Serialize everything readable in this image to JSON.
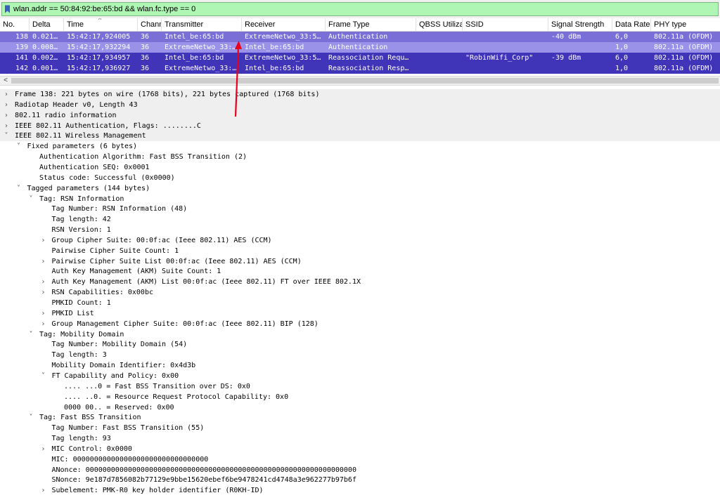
{
  "filter": {
    "value": "wlan.addr == 50:84:92:be:65:bd && wlan.fc.type == 0",
    "icon": "bookmark-icon"
  },
  "packet_list": {
    "columns": [
      "No.",
      "Delta",
      "Time",
      "Channel",
      "Transmitter",
      "Receiver",
      "Frame Type",
      "QBSS Utilization",
      "SSID",
      "Signal Strength",
      "Data Rate",
      "PHY type"
    ],
    "columns_shown": [
      "No.",
      "Delta",
      "Time",
      "Chann",
      "Transmitter",
      "Receiver",
      "Frame Type",
      "QBSS Utiliza",
      "SSID",
      "Signal Strength",
      "Data Rate",
      "PHY type"
    ],
    "rows": [
      {
        "no": "138",
        "delta": "0.021…",
        "time": "15:42:17,924005",
        "channel": "36",
        "transmitter": "Intel_be:65:bd",
        "receiver": "ExtremeNetwo_33:5…",
        "frame_type": "Authentication",
        "qbss": "",
        "ssid": "",
        "signal": "-40 dBm",
        "rate": "6,0",
        "phy": "802.11a (OFDM)"
      },
      {
        "no": "139",
        "delta": "0.008…",
        "time": "15:42:17,932294",
        "channel": "36",
        "transmitter": "ExtremeNetwo_33:…",
        "receiver": "Intel_be:65:bd",
        "frame_type": "Authentication",
        "qbss": "",
        "ssid": "",
        "signal": "",
        "rate": "1,0",
        "phy": "802.11a (OFDM)"
      },
      {
        "no": "141",
        "delta": "0.002…",
        "time": "15:42:17,934957",
        "channel": "36",
        "transmitter": "Intel_be:65:bd",
        "receiver": "ExtremeNetwo_33:5…",
        "frame_type": "Reassociation Requ…",
        "qbss": "",
        "ssid": "\"RobinWifi_Corp\"",
        "signal": "-39 dBm",
        "rate": "6,0",
        "phy": "802.11a (OFDM)"
      },
      {
        "no": "142",
        "delta": "0.001…",
        "time": "15:42:17,936927",
        "channel": "36",
        "transmitter": "ExtremeNetwo_33:…",
        "receiver": "Intel_be:65:bd",
        "frame_type": "Reassociation Resp…",
        "qbss": "",
        "ssid": "",
        "signal": "",
        "rate": "1,0",
        "phy": "802.11a (OFDM)"
      }
    ]
  },
  "scrollbar": {
    "left_arrow": "<"
  },
  "details": [
    {
      "level": 0,
      "toggle": ">",
      "text": "Frame 138: 221 bytes on wire (1768 bits), 221 bytes captured (1768 bits)"
    },
    {
      "level": 0,
      "toggle": ">",
      "text": "Radiotap Header v0, Length 43"
    },
    {
      "level": 0,
      "toggle": ">",
      "text": "802.11 radio information"
    },
    {
      "level": 0,
      "toggle": ">",
      "text": "IEEE 802.11 Authentication, Flags: ........C"
    },
    {
      "level": 0,
      "toggle": "v",
      "text": "IEEE 802.11 Wireless Management"
    },
    {
      "level": 1,
      "toggle": "v",
      "text": "Fixed parameters (6 bytes)"
    },
    {
      "level": 2,
      "toggle": "",
      "text": "Authentication Algorithm: Fast BSS Transition (2)"
    },
    {
      "level": 2,
      "toggle": "",
      "text": "Authentication SEQ: 0x0001"
    },
    {
      "level": 2,
      "toggle": "",
      "text": "Status code: Successful (0x0000)"
    },
    {
      "level": 1,
      "toggle": "v",
      "text": "Tagged parameters (144 bytes)"
    },
    {
      "level": 2,
      "toggle": "v",
      "text": "Tag: RSN Information"
    },
    {
      "level": 3,
      "toggle": "",
      "text": "Tag Number: RSN Information (48)"
    },
    {
      "level": 3,
      "toggle": "",
      "text": "Tag length: 42"
    },
    {
      "level": 3,
      "toggle": "",
      "text": "RSN Version: 1"
    },
    {
      "level": 3,
      "toggle": ">",
      "text": "Group Cipher Suite: 00:0f:ac (Ieee 802.11) AES (CCM)"
    },
    {
      "level": 3,
      "toggle": "",
      "text": "Pairwise Cipher Suite Count: 1"
    },
    {
      "level": 3,
      "toggle": ">",
      "text": "Pairwise Cipher Suite List 00:0f:ac (Ieee 802.11) AES (CCM)"
    },
    {
      "level": 3,
      "toggle": "",
      "text": "Auth Key Management (AKM) Suite Count: 1"
    },
    {
      "level": 3,
      "toggle": ">",
      "text": "Auth Key Management (AKM) List 00:0f:ac (Ieee 802.11) FT over IEEE 802.1X"
    },
    {
      "level": 3,
      "toggle": ">",
      "text": "RSN Capabilities: 0x00bc"
    },
    {
      "level": 3,
      "toggle": "",
      "text": "PMKID Count: 1"
    },
    {
      "level": 3,
      "toggle": ">",
      "text": "PMKID List"
    },
    {
      "level": 3,
      "toggle": ">",
      "text": "Group Management Cipher Suite: 00:0f:ac (Ieee 802.11) BIP (128)"
    },
    {
      "level": 2,
      "toggle": "v",
      "text": "Tag: Mobility Domain"
    },
    {
      "level": 3,
      "toggle": "",
      "text": "Tag Number: Mobility Domain (54)"
    },
    {
      "level": 3,
      "toggle": "",
      "text": "Tag length: 3"
    },
    {
      "level": 3,
      "toggle": "",
      "text": "Mobility Domain Identifier: 0x4d3b"
    },
    {
      "level": 3,
      "toggle": "v",
      "text": "FT Capability and Policy: 0x00"
    },
    {
      "level": 4,
      "toggle": "",
      "text": ".... ...0 = Fast BSS Transition over DS: 0x0"
    },
    {
      "level": 4,
      "toggle": "",
      "text": ".... ..0. = Resource Request Protocol Capability: 0x0"
    },
    {
      "level": 4,
      "toggle": "",
      "text": "0000 00.. = Reserved: 0x00"
    },
    {
      "level": 2,
      "toggle": "v",
      "text": "Tag: Fast BSS Transition"
    },
    {
      "level": 3,
      "toggle": "",
      "text": "Tag Number: Fast BSS Transition (55)"
    },
    {
      "level": 3,
      "toggle": "",
      "text": "Tag length: 93"
    },
    {
      "level": 3,
      "toggle": ">",
      "text": "MIC Control: 0x0000"
    },
    {
      "level": 3,
      "toggle": "",
      "text": "MIC: 00000000000000000000000000000000"
    },
    {
      "level": 3,
      "toggle": "",
      "text": "ANonce: 0000000000000000000000000000000000000000000000000000000000000000"
    },
    {
      "level": 3,
      "toggle": "",
      "text": "SNonce: 9e187d7856082b77129e9bbe15620ebef6be9478241cd4748a3e962277b97b6f"
    },
    {
      "level": 3,
      "toggle": ">",
      "text": "Subelement: PMK-R0 key holder identifier (R0KH-ID)"
    }
  ],
  "colors": {
    "filter_bg": "#aff5b4",
    "row_selected": "#7a6fd6",
    "row_light": "#9a91e8",
    "row_dark": "#4034b9",
    "arrow": "#e8001c"
  }
}
